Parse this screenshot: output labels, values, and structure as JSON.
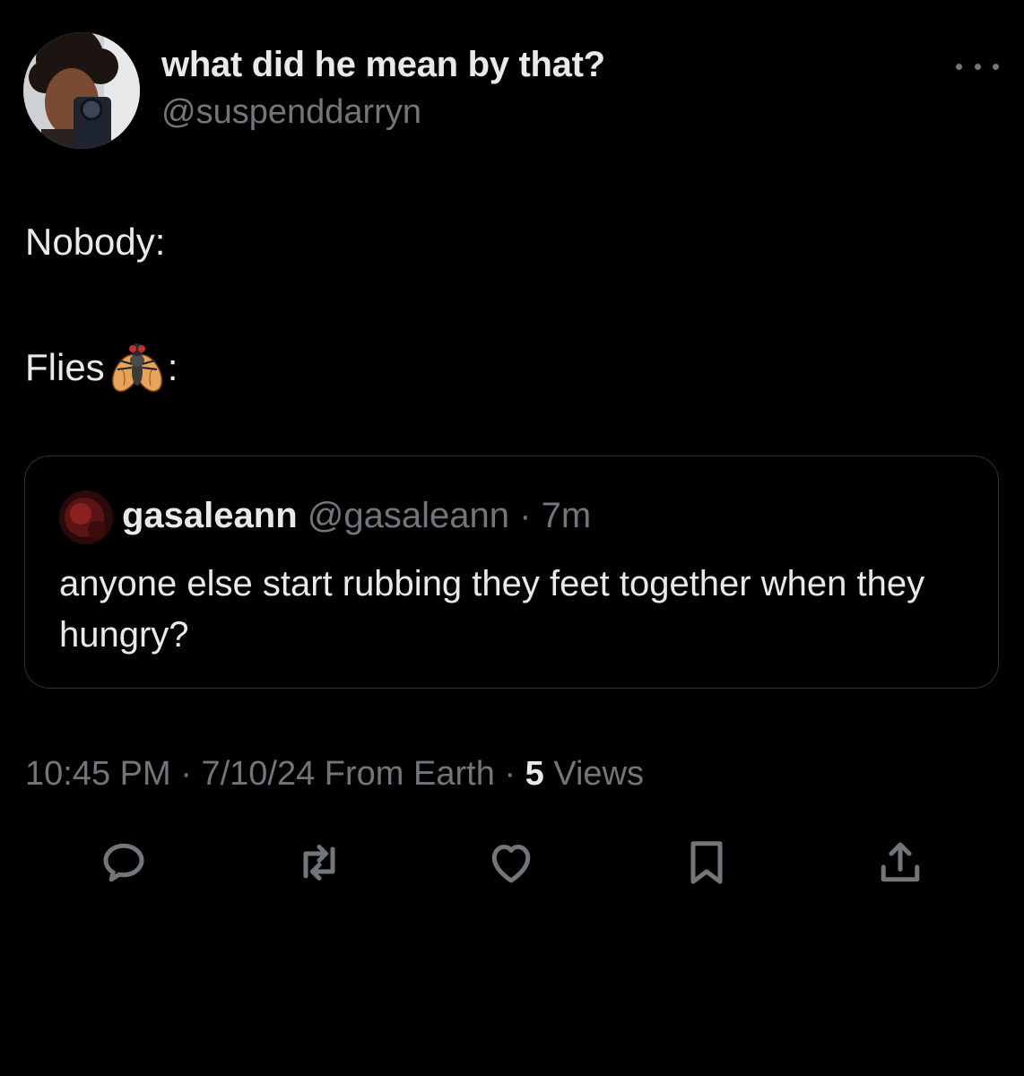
{
  "author": {
    "display_name": "what did he mean by that?",
    "handle": "@suspenddarryn"
  },
  "tweet": {
    "line1": "Nobody:",
    "line2_prefix": "Flies",
    "line2_emoji": "fly-emoji",
    "line2_suffix": ":"
  },
  "quoted": {
    "name": "gasaleann",
    "handle": "@gasaleann",
    "separator": "·",
    "time": "7m",
    "text": "anyone else start rubbing they feet together when they hungry?"
  },
  "meta": {
    "time": "10:45 PM",
    "sep1": "·",
    "date": "7/10/24",
    "source": "From Earth",
    "sep2": "·",
    "views_count": "5",
    "views_label": "Views"
  },
  "actions": [
    "reply-icon",
    "retweet-icon",
    "like-icon",
    "bookmark-icon",
    "share-icon"
  ],
  "colors": {
    "background": "#000000",
    "text_primary": "#e7e9ea",
    "text_secondary": "#71767b",
    "border": "#2f3336"
  }
}
